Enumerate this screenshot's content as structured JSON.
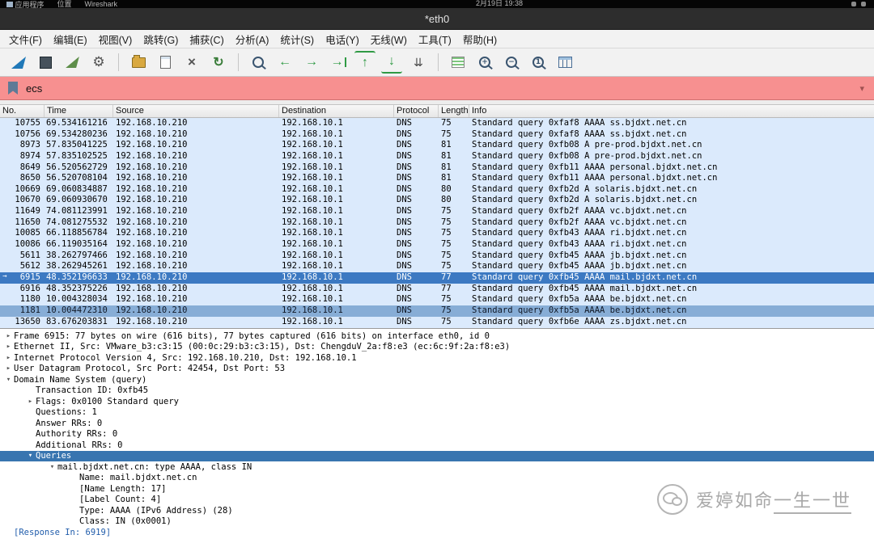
{
  "top_bar": {
    "items": [
      "应用程序",
      "位置",
      "Wireshark"
    ],
    "clock": "2月19日 19:38"
  },
  "title_bar": {
    "title": "*eth0"
  },
  "menu_bar": {
    "items": [
      "文件(F)",
      "编辑(E)",
      "视图(V)",
      "跳转(G)",
      "捕获(C)",
      "分析(A)",
      "统计(S)",
      "电话(Y)",
      "无线(W)",
      "工具(T)",
      "帮助(H)"
    ]
  },
  "toolbar": {
    "icons": [
      "start-capture",
      "stop-capture",
      "restart-capture",
      "capture-options",
      "open-file",
      "save-file",
      "close-file",
      "reload-file",
      "find-packet",
      "go-previous",
      "go-next",
      "go-to-packet",
      "go-first",
      "go-last",
      "auto-scroll",
      "colorize",
      "zoom-in",
      "zoom-out",
      "zoom-original",
      "resize-columns"
    ]
  },
  "filter_bar": {
    "value": "ecs",
    "state_color": "#f79090"
  },
  "packet_list": {
    "columns": [
      "No.",
      "Time",
      "Source",
      "Destination",
      "Protocol",
      "Length",
      "Info"
    ],
    "rows": [
      {
        "mark": "",
        "no": "10755",
        "time": "69.534161216",
        "src": "192.168.10.210",
        "dst": "192.168.10.1",
        "proto": "DNS",
        "len": "75",
        "info": "Standard query 0xfaf8 AAAA ss.bjdxt.net.cn"
      },
      {
        "mark": "",
        "no": "10756",
        "time": "69.534280236",
        "src": "192.168.10.210",
        "dst": "192.168.10.1",
        "proto": "DNS",
        "len": "75",
        "info": "Standard query 0xfaf8 AAAA ss.bjdxt.net.cn"
      },
      {
        "mark": "",
        "no": "8973",
        "time": "57.835041225",
        "src": "192.168.10.210",
        "dst": "192.168.10.1",
        "proto": "DNS",
        "len": "81",
        "info": "Standard query 0xfb08 A pre-prod.bjdxt.net.cn"
      },
      {
        "mark": "",
        "no": "8974",
        "time": "57.835102525",
        "src": "192.168.10.210",
        "dst": "192.168.10.1",
        "proto": "DNS",
        "len": "81",
        "info": "Standard query 0xfb08 A pre-prod.bjdxt.net.cn"
      },
      {
        "mark": "",
        "no": "8649",
        "time": "56.520562729",
        "src": "192.168.10.210",
        "dst": "192.168.10.1",
        "proto": "DNS",
        "len": "81",
        "info": "Standard query 0xfb11 AAAA personal.bjdxt.net.cn"
      },
      {
        "mark": "",
        "no": "8650",
        "time": "56.520708104",
        "src": "192.168.10.210",
        "dst": "192.168.10.1",
        "proto": "DNS",
        "len": "81",
        "info": "Standard query 0xfb11 AAAA personal.bjdxt.net.cn"
      },
      {
        "mark": "",
        "no": "10669",
        "time": "69.060834887",
        "src": "192.168.10.210",
        "dst": "192.168.10.1",
        "proto": "DNS",
        "len": "80",
        "info": "Standard query 0xfb2d A solaris.bjdxt.net.cn"
      },
      {
        "mark": "",
        "no": "10670",
        "time": "69.060930670",
        "src": "192.168.10.210",
        "dst": "192.168.10.1",
        "proto": "DNS",
        "len": "80",
        "info": "Standard query 0xfb2d A solaris.bjdxt.net.cn"
      },
      {
        "mark": "",
        "no": "11649",
        "time": "74.081123991",
        "src": "192.168.10.210",
        "dst": "192.168.10.1",
        "proto": "DNS",
        "len": "75",
        "info": "Standard query 0xfb2f AAAA vc.bjdxt.net.cn"
      },
      {
        "mark": "",
        "no": "11650",
        "time": "74.081275532",
        "src": "192.168.10.210",
        "dst": "192.168.10.1",
        "proto": "DNS",
        "len": "75",
        "info": "Standard query 0xfb2f AAAA vc.bjdxt.net.cn"
      },
      {
        "mark": "",
        "no": "10085",
        "time": "66.118856784",
        "src": "192.168.10.210",
        "dst": "192.168.10.1",
        "proto": "DNS",
        "len": "75",
        "info": "Standard query 0xfb43 AAAA ri.bjdxt.net.cn"
      },
      {
        "mark": "",
        "no": "10086",
        "time": "66.119035164",
        "src": "192.168.10.210",
        "dst": "192.168.10.1",
        "proto": "DNS",
        "len": "75",
        "info": "Standard query 0xfb43 AAAA ri.bjdxt.net.cn"
      },
      {
        "mark": "",
        "no": "5611",
        "time": "38.262797466",
        "src": "192.168.10.210",
        "dst": "192.168.10.1",
        "proto": "DNS",
        "len": "75",
        "info": "Standard query 0xfb45 AAAA jb.bjdxt.net.cn"
      },
      {
        "mark": "",
        "no": "5612",
        "time": "38.262945261",
        "src": "192.168.10.210",
        "dst": "192.168.10.1",
        "proto": "DNS",
        "len": "75",
        "info": "Standard query 0xfb45 AAAA jb.bjdxt.net.cn"
      },
      {
        "mark": "→",
        "no": "6915",
        "time": "48.352196633",
        "src": "192.168.10.210",
        "dst": "192.168.10.1",
        "proto": "DNS",
        "len": "77",
        "info": "Standard query 0xfb45 AAAA mail.bjdxt.net.cn",
        "cls": "sel"
      },
      {
        "mark": "",
        "no": "6916",
        "time": "48.352375226",
        "src": "192.168.10.210",
        "dst": "192.168.10.1",
        "proto": "DNS",
        "len": "77",
        "info": "Standard query 0xfb45 AAAA mail.bjdxt.net.cn"
      },
      {
        "mark": "",
        "no": "1180",
        "time": "10.004328034",
        "src": "192.168.10.210",
        "dst": "192.168.10.1",
        "proto": "DNS",
        "len": "75",
        "info": "Standard query 0xfb5a AAAA be.bjdxt.net.cn"
      },
      {
        "mark": "",
        "no": "1181",
        "time": "10.004472310",
        "src": "192.168.10.210",
        "dst": "192.168.10.1",
        "proto": "DNS",
        "len": "75",
        "info": "Standard query 0xfb5a AAAA be.bjdxt.net.cn",
        "cls": "rel"
      },
      {
        "mark": "",
        "no": "13650",
        "time": "83.676203831",
        "src": "192.168.10.210",
        "dst": "192.168.10.1",
        "proto": "DNS",
        "len": "75",
        "info": "Standard query 0xfb6e AAAA zs.bjdxt.net.cn"
      }
    ]
  },
  "details": {
    "lines": [
      {
        "arrow": "▸",
        "indent": 0,
        "text": "Frame 6915: 77 bytes on wire (616 bits), 77 bytes captured (616 bits) on interface eth0, id 0"
      },
      {
        "arrow": "▸",
        "indent": 0,
        "text": "Ethernet II, Src: VMware_b3:c3:15 (00:0c:29:b3:c3:15), Dst: ChengduV_2a:f8:e3 (ec:6c:9f:2a:f8:e3)"
      },
      {
        "arrow": "▸",
        "indent": 0,
        "text": "Internet Protocol Version 4, Src: 192.168.10.210, Dst: 192.168.10.1"
      },
      {
        "arrow": "▸",
        "indent": 0,
        "text": "User Datagram Protocol, Src Port: 42454, Dst Port: 53"
      },
      {
        "arrow": "▾",
        "indent": 0,
        "text": "Domain Name System (query)"
      },
      {
        "arrow": "",
        "indent": 1,
        "text": "Transaction ID: 0xfb45"
      },
      {
        "arrow": "▸",
        "indent": 1,
        "text": "Flags: 0x0100 Standard query"
      },
      {
        "arrow": "",
        "indent": 1,
        "text": "Questions: 1"
      },
      {
        "arrow": "",
        "indent": 1,
        "text": "Answer RRs: 0"
      },
      {
        "arrow": "",
        "indent": 1,
        "text": "Authority RRs: 0"
      },
      {
        "arrow": "",
        "indent": 1,
        "text": "Additional RRs: 0"
      },
      {
        "arrow": "▾",
        "indent": 1,
        "text": "Queries",
        "cls": "sel"
      },
      {
        "arrow": "▾",
        "indent": 2,
        "text": "mail.bjdxt.net.cn: type AAAA, class IN"
      },
      {
        "arrow": "",
        "indent": 3,
        "text": "Name: mail.bjdxt.net.cn"
      },
      {
        "arrow": "",
        "indent": 3,
        "text": "[Name Length: 17]"
      },
      {
        "arrow": "",
        "indent": 3,
        "text": "[Label Count: 4]"
      },
      {
        "arrow": "",
        "indent": 3,
        "text": "Type: AAAA (IPv6 Address) (28)"
      },
      {
        "arrow": "",
        "indent": 3,
        "text": "Class: IN (0x0001)"
      },
      {
        "arrow": "",
        "indent": 0,
        "text": "[Response In: 6919]",
        "cls": "link"
      }
    ]
  },
  "watermark": {
    "text_a": "爱婷如命",
    "text_b": "一生一世"
  },
  "colors": {
    "selection_blue": "#3c79c2",
    "related_blue": "#87add6",
    "dns_row_blue": "#dbeafc",
    "filter_invalid_pink": "#f79090"
  }
}
